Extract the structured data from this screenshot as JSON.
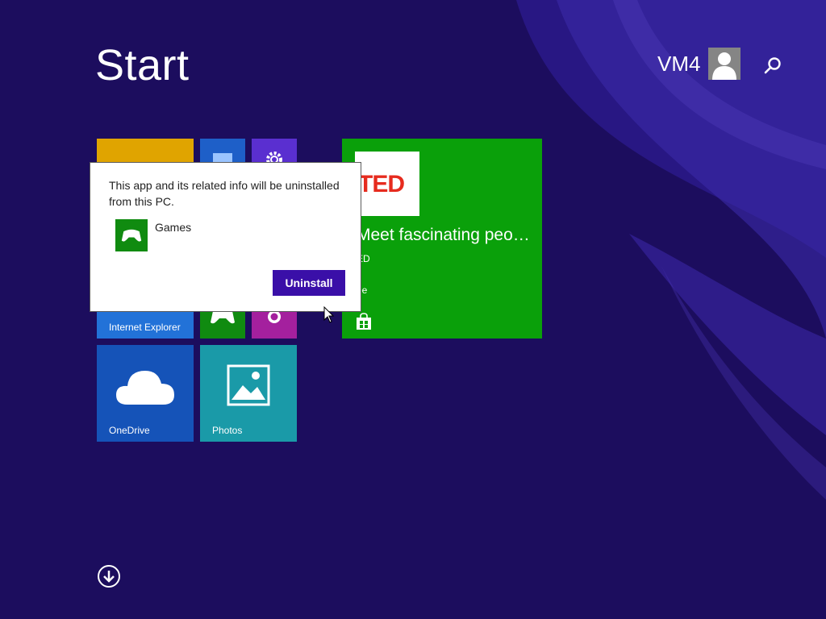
{
  "start": {
    "title": "Start"
  },
  "user": {
    "name": "VM4",
    "avatar_icon": "user-silhouette-icon"
  },
  "search": {
    "icon": "search-icon"
  },
  "tiles": {
    "internet_explorer": {
      "label": "Internet Explorer",
      "color": "#2272d8"
    },
    "onedrive": {
      "label": "OneDrive",
      "color": "#1553b8"
    },
    "photos": {
      "label": "Photos",
      "color": "#1a9aa8"
    },
    "store": {
      "title": "Meet fascinating peo…",
      "subtitle": "ED",
      "price": "ee",
      "logo_text": "TED",
      "color": "#0aa00a"
    }
  },
  "dialog": {
    "message": "This app and its related info will be uninstalled from this PC.",
    "app_name": "Games",
    "uninstall_label": "Uninstall"
  },
  "colors": {
    "background": "#1c0d5e",
    "accent": "#3a0fa8",
    "store_green": "#0aa00a"
  }
}
